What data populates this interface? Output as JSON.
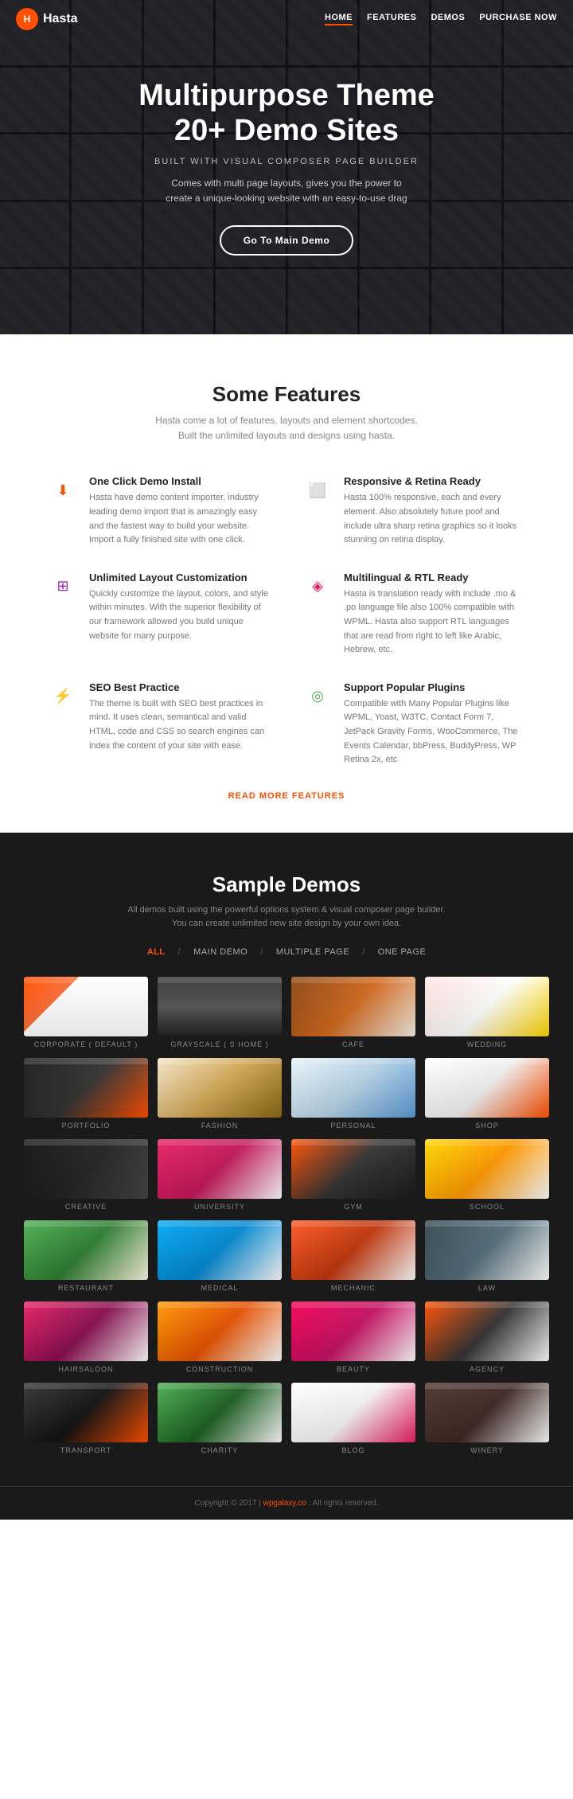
{
  "nav": {
    "logo_icon": "H",
    "logo_text": "Hasta",
    "links": [
      "HOME",
      "FEATURES",
      "DEMOS",
      "PURCHASE NOW"
    ],
    "active": "HOME"
  },
  "hero": {
    "title": "Multipurpose Theme\n20+ Demo Sites",
    "subtitle": "BUILT WITH VISUAL COMPOSER PAGE BUILDER",
    "description": "Comes with multi page layouts, gives you the power to create a unique-looking website with an easy-to-use drag",
    "cta": "Go To Main Demo"
  },
  "features": {
    "title": "Some Features",
    "subtitle": "Hasta come a lot of features, layouts and element shortcodes.\nBuilt the unlimited layouts and designs using hasta.",
    "items": [
      {
        "icon": "⬇",
        "color": "orange",
        "title": "One Click Demo Install",
        "desc": "Hasta have demo content importer, industry leading demo import that is amazingly easy and the fastest way to build your website. Import a fully finished site with one click."
      },
      {
        "icon": "◻",
        "color": "teal",
        "title": "Responsive & Retina Ready",
        "desc": "Hasta 100% responsive, each and every element. Also absolutely future poof and include ultra sharp retina graphics so it looks stunning on retina display."
      },
      {
        "icon": "⊞",
        "color": "purple",
        "title": "Unlimited Layout Customization",
        "desc": "Quickly customize the layout, colors, and style within minutes. With the superior flexibility of our framework allowed you build unique website for many purpose."
      },
      {
        "icon": "◈",
        "color": "pink",
        "title": "Multilingual & RTL Ready",
        "desc": "Hasta is translation ready with include .mo & .po language file also 100% compatible with WPML. Hasta also support RTL languages that are read from right to left like Arabic, Hebrew, etc."
      },
      {
        "icon": "⚡",
        "color": "yellow",
        "title": "SEO Best Practice",
        "desc": "The theme is built with SEO best practices in mind. It uses clean, semantical and valid HTML, code and CSS so search engines can index the content of your site with ease."
      },
      {
        "icon": "◎",
        "color": "green",
        "title": "Support Popular Plugins",
        "desc": "Compatible with Many Popular Plugins like WPML, Yoast, W3TC, Contact Form 7, JetPack Gravity Forms, WooCommerce, The Events Calendar, bbPress, BuddyPress, WP Retina 2x, etc"
      }
    ],
    "read_more": "READ MORE FEATURES"
  },
  "demos": {
    "title": "Sample Demos",
    "subtitle": "All demos built using the powerful options system & visual composer page builder.\nYou can create unlimited new site design by your own idea.",
    "filters": [
      "ALL",
      "MAIN DEMO",
      "MULTIPLE PAGE",
      "ONE PAGE"
    ],
    "active_filter": "ALL",
    "items": [
      {
        "label": "CORPORATE ( DEFAULT )",
        "thumb": "corporate"
      },
      {
        "label": "GRAYSCALE ( S HOME )",
        "thumb": "grayscale"
      },
      {
        "label": "CAFE",
        "thumb": "cafe"
      },
      {
        "label": "WEDDING",
        "thumb": "wedding"
      },
      {
        "label": "PORTFOLIO",
        "thumb": "portfolio"
      },
      {
        "label": "FASHION",
        "thumb": "fashion"
      },
      {
        "label": "PERSONAL",
        "thumb": "personal"
      },
      {
        "label": "SHOP",
        "thumb": "shop"
      },
      {
        "label": "CREATIVE",
        "thumb": "creative"
      },
      {
        "label": "UNIVERSITY",
        "thumb": "university"
      },
      {
        "label": "GYM",
        "thumb": "gym"
      },
      {
        "label": "SCHOOL",
        "thumb": "school"
      },
      {
        "label": "RESTAURANT",
        "thumb": "restaurant"
      },
      {
        "label": "MEDICAL",
        "thumb": "medical"
      },
      {
        "label": "MECHANIC",
        "thumb": "mechanic"
      },
      {
        "label": "LAW",
        "thumb": "law"
      },
      {
        "label": "HAIRSALOON",
        "thumb": "hairsaloon"
      },
      {
        "label": "CONSTRUCTION",
        "thumb": "construction"
      },
      {
        "label": "BEAUTY",
        "thumb": "beauty"
      },
      {
        "label": "AGENCY",
        "thumb": "agency"
      },
      {
        "label": "TRANSPORT",
        "thumb": "transport"
      },
      {
        "label": "CHARITY",
        "thumb": "charity"
      },
      {
        "label": "BLOG",
        "thumb": "blog"
      },
      {
        "label": "WINERY",
        "thumb": "winery"
      }
    ]
  },
  "footer": {
    "text": "Copyright © 2017 |",
    "link_text": "wpgalaxy.co",
    "link_suffix": ". All rights reserved."
  }
}
